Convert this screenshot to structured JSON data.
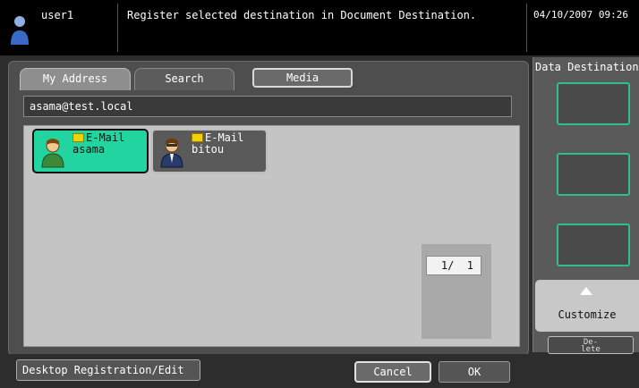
{
  "header": {
    "user_name": "user1",
    "message": "Register selected destination in Document Destination.",
    "datetime": "04/10/2007 09:26"
  },
  "tabs": {
    "my_address": "My Address",
    "search": "Search",
    "media": "Media"
  },
  "address_field": {
    "value": "asama@test.local"
  },
  "destinations": [
    {
      "type": "E-Mail",
      "name": "asama",
      "icon": "person-icon",
      "selected": true
    },
    {
      "type": "E-Mail",
      "name": "bitou",
      "icon": "person-icon",
      "selected": false
    }
  ],
  "pager": {
    "text": "1/  1"
  },
  "footer": {
    "desktop_registration": "Desktop Registration/Edit",
    "cancel": "Cancel",
    "ok": "OK"
  },
  "sidebar": {
    "title": "Data Destination",
    "customize": "Customize",
    "delete": "De-\nlete"
  },
  "colors": {
    "selected_card": "#22d4a0",
    "slot_border": "#2fc08a",
    "header_bg": "#000000"
  }
}
